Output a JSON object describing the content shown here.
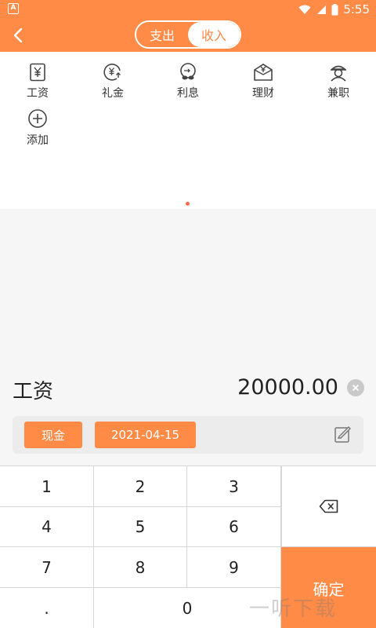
{
  "status_bar": {
    "app_badge": "A",
    "time": "5:55"
  },
  "header": {
    "back_icon": "chevron-left-icon",
    "tabs": [
      {
        "label": "支出",
        "active": false
      },
      {
        "label": "收入",
        "active": true
      }
    ]
  },
  "categories": [
    {
      "label": "工资",
      "icon": "salary-icon"
    },
    {
      "label": "礼金",
      "icon": "gift-money-icon"
    },
    {
      "label": "利息",
      "icon": "interest-icon"
    },
    {
      "label": "理财",
      "icon": "finance-icon"
    },
    {
      "label": "兼职",
      "icon": "part-time-icon"
    },
    {
      "label": "添加",
      "icon": "add-icon"
    }
  ],
  "entry": {
    "category": "工资",
    "amount": "20000.00"
  },
  "options": {
    "account": "现金",
    "date": "2021-04-15"
  },
  "keypad": {
    "keys": [
      "1",
      "2",
      "3",
      "4",
      "5",
      "6",
      "7",
      "8",
      "9",
      ".",
      "0"
    ],
    "confirm_label": "确定"
  },
  "watermark": "一听下载",
  "colors": {
    "accent": "#ff8b47",
    "background": "#f6f6f6"
  }
}
